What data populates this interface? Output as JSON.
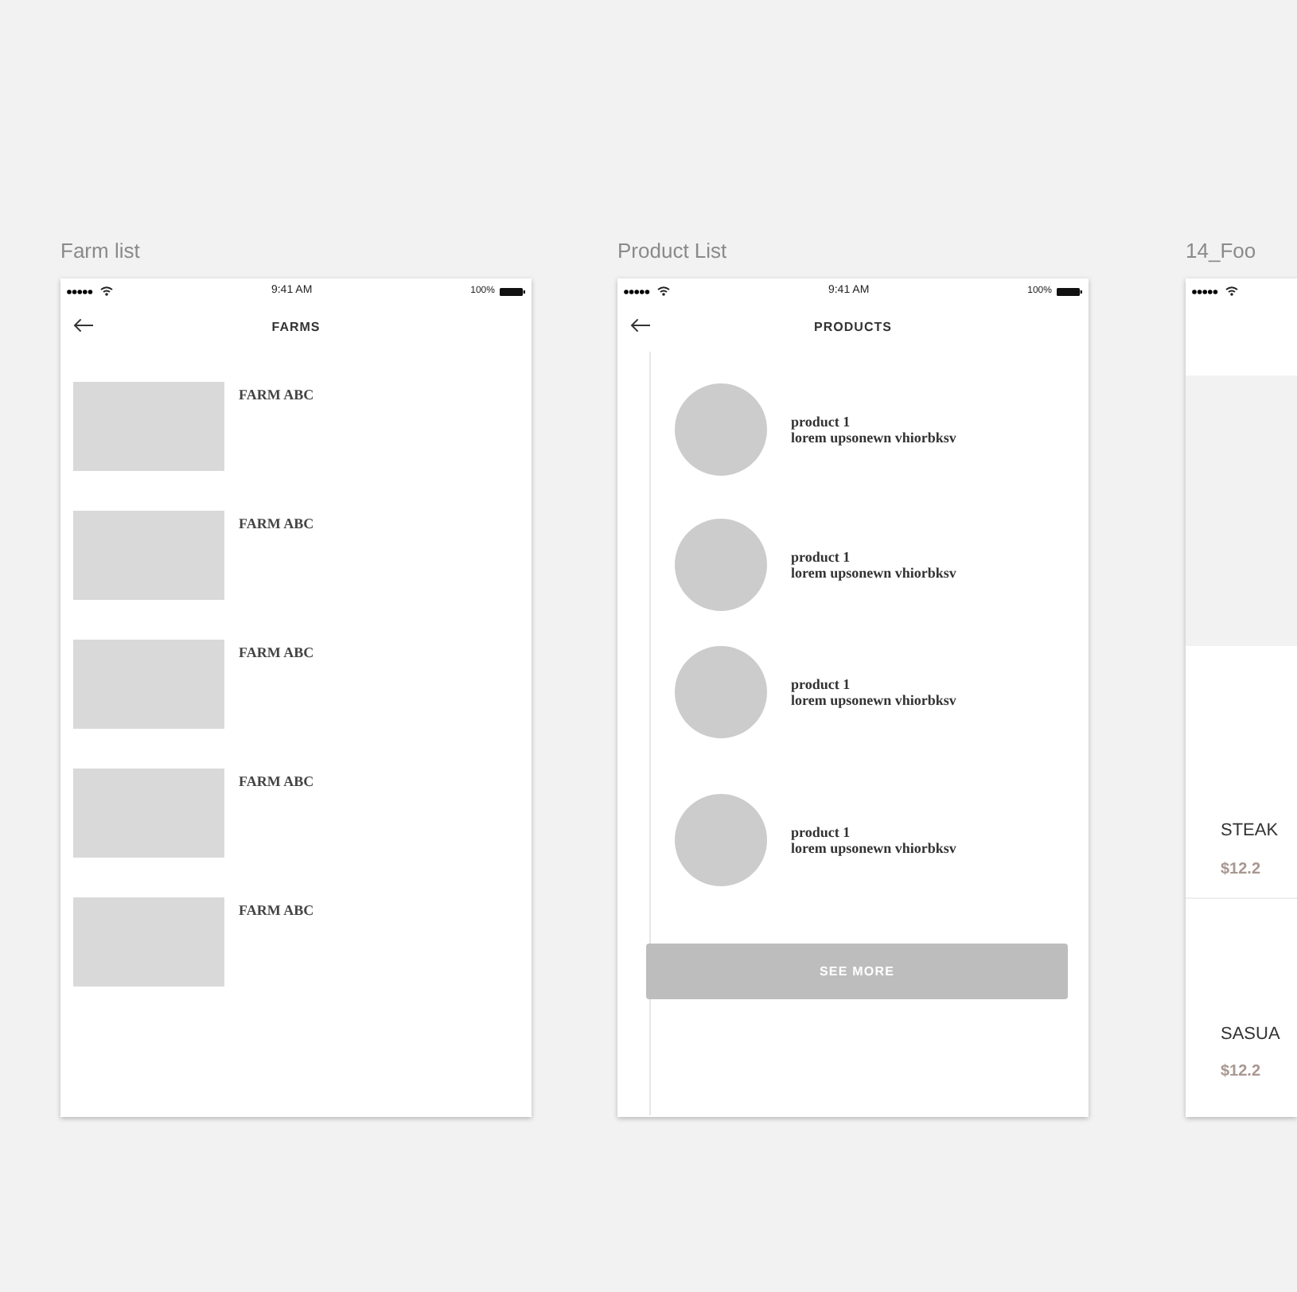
{
  "artboards": [
    {
      "kind": "farms",
      "title": "Farm list",
      "status": {
        "time": "9:41 AM",
        "battery": "100%"
      },
      "header": "FARMS",
      "items": [
        "FARM ABC",
        "FARM ABC",
        "FARM ABC",
        "FARM ABC",
        "FARM ABC"
      ]
    },
    {
      "kind": "products",
      "title": "Product List",
      "status": {
        "time": "9:41 AM",
        "battery": "100%"
      },
      "header": "PRODUCTS",
      "items": [
        {
          "name": "product 1",
          "desc": "lorem upsonewn vhiorbksv"
        },
        {
          "name": "product 1",
          "desc": "lorem upsonewn vhiorbksv"
        },
        {
          "name": "product 1",
          "desc": "lorem upsonewn vhiorbksv"
        },
        {
          "name": "product 1",
          "desc": "lorem upsonewn vhiorbksv"
        }
      ],
      "button": "SEE MORE"
    },
    {
      "kind": "food",
      "title": "14_Foo",
      "items": [
        {
          "name": "STEAK",
          "price": "$12.2"
        },
        {
          "name": "SASUA",
          "price": "$12.2"
        }
      ]
    }
  ]
}
